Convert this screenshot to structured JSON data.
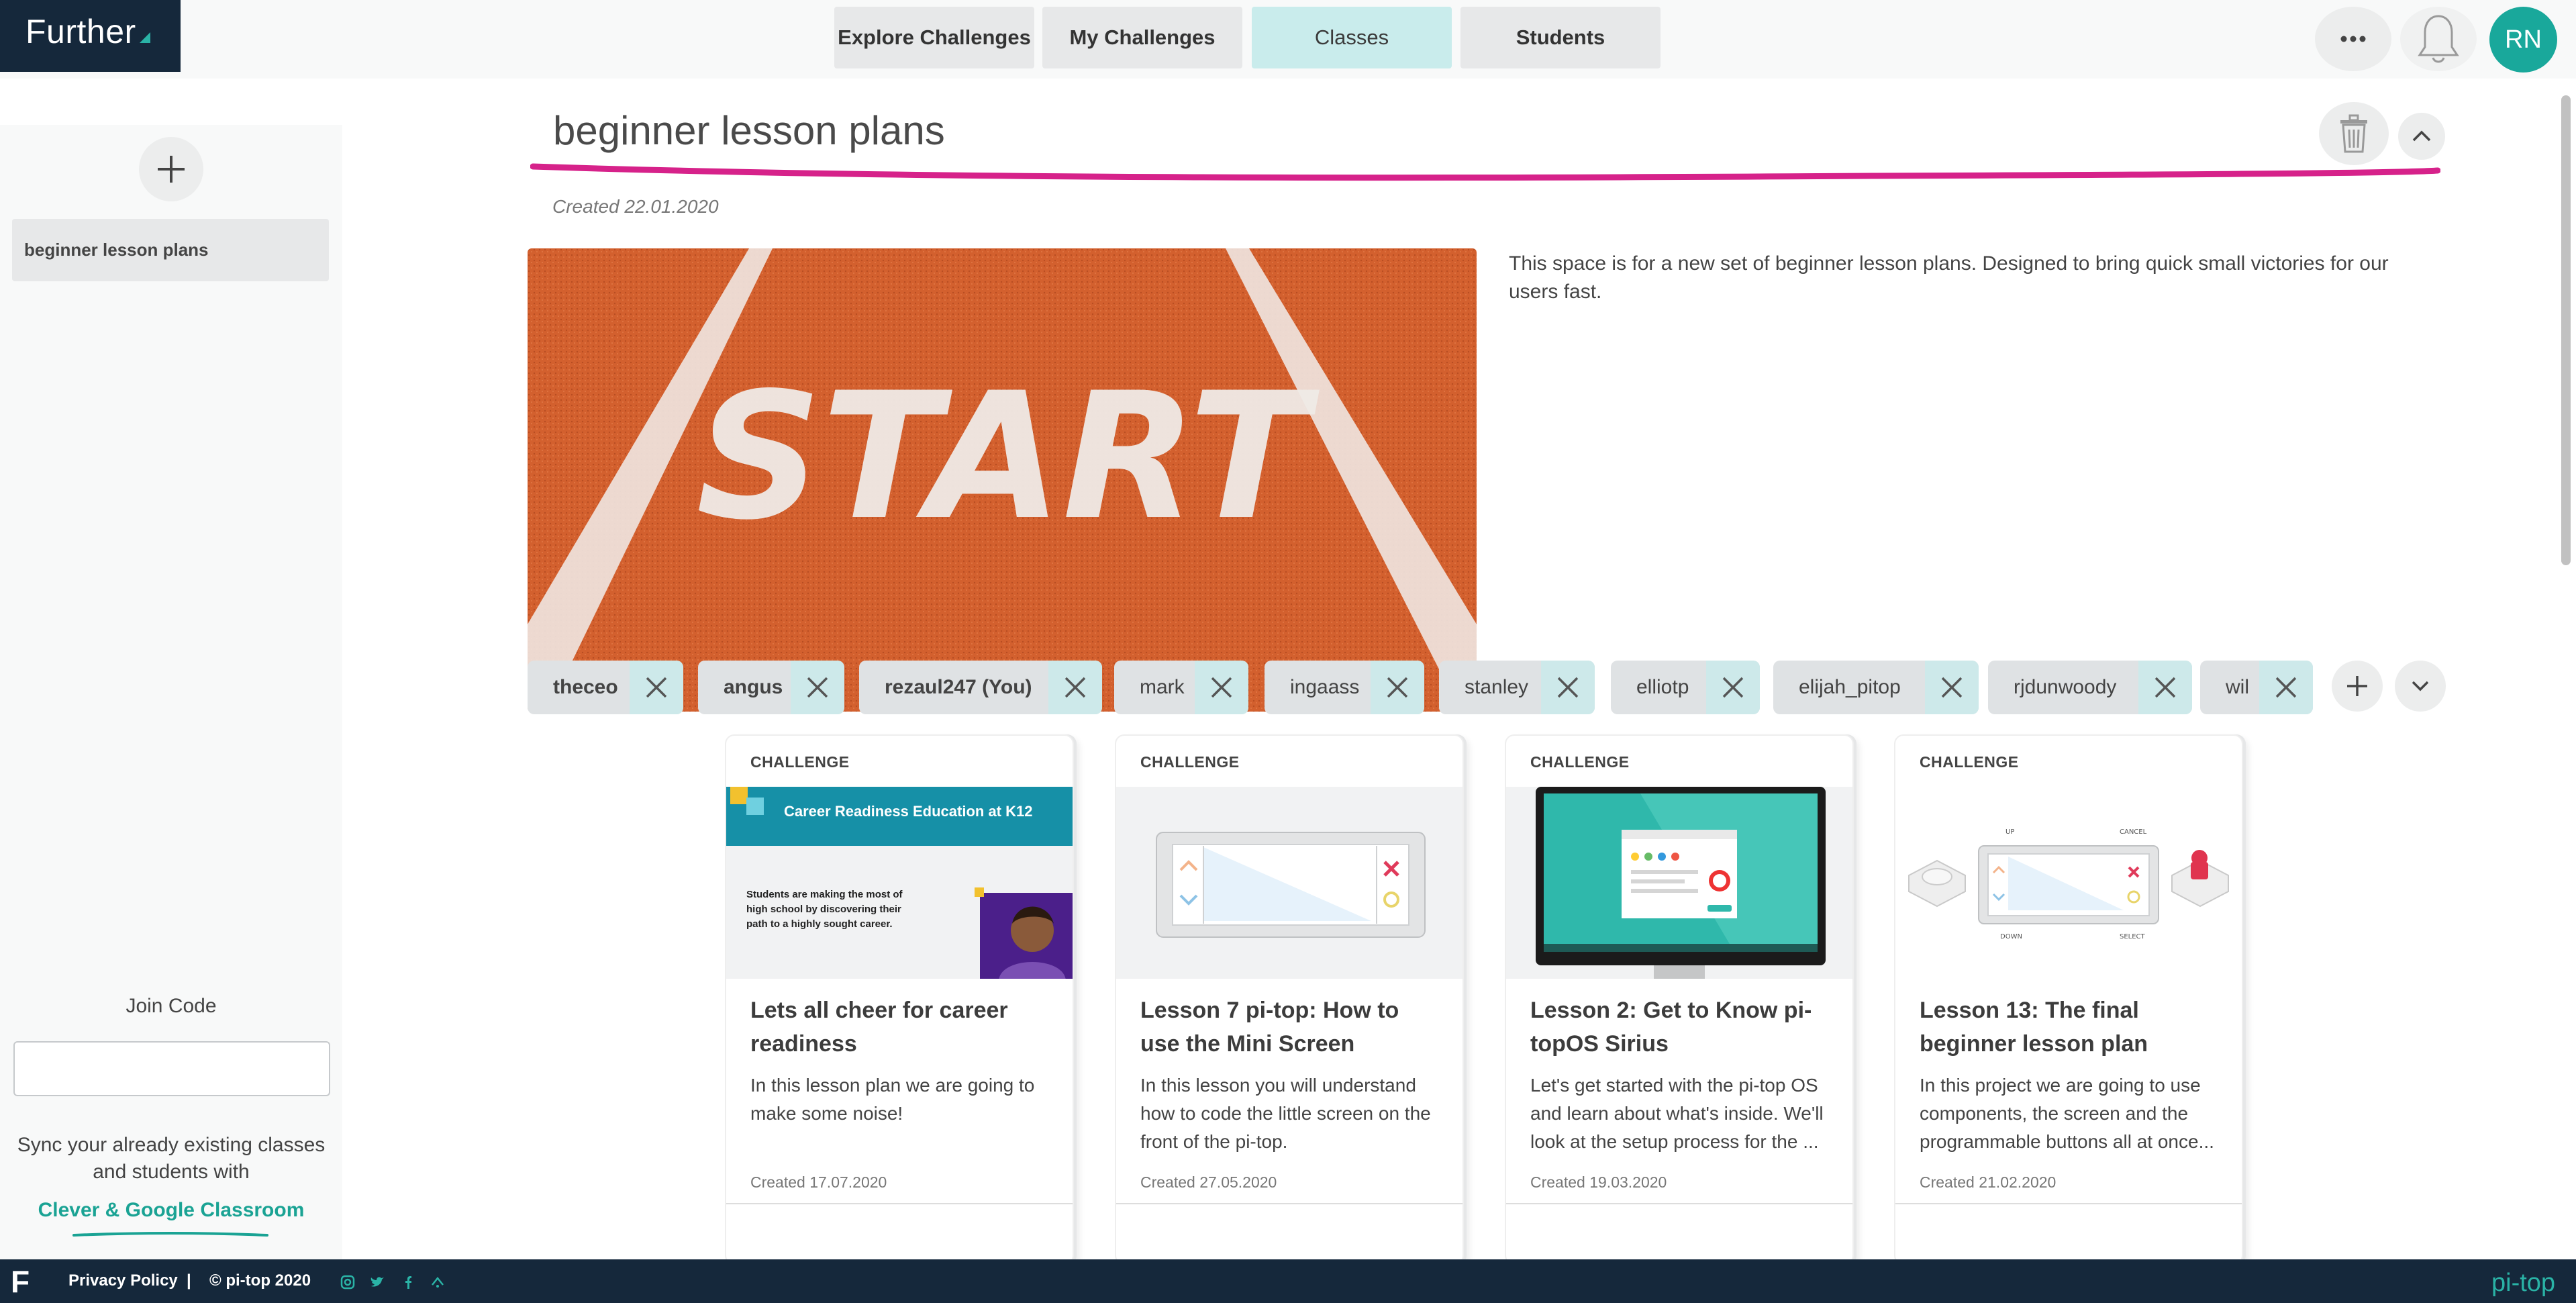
{
  "app": {
    "logo_text": "Further",
    "user_initials": "RN"
  },
  "nav": {
    "tabs": [
      {
        "label": "Explore Challenges"
      },
      {
        "label": "My Challenges"
      },
      {
        "label": "Classes",
        "active": true
      },
      {
        "label": "Students"
      }
    ]
  },
  "sidebar": {
    "items": [
      {
        "label": "beginner lesson plans",
        "selected": true
      }
    ],
    "join_code_label": "Join Code",
    "join_code_value": "",
    "sync_text": "Sync your already existing classes and students with",
    "sync_link": "Clever & Google Classroom"
  },
  "class": {
    "title": "beginner lesson plans",
    "created": "Created 22.01.2020",
    "hero_text": "START",
    "description": "This space is for a new set of beginner lesson plans. Designed to bring quick small victories for our users fast.",
    "students": [
      {
        "name": "theceo",
        "bold": true
      },
      {
        "name": "angus",
        "bold": true
      },
      {
        "name": "rezaul247 (You)",
        "bold": true
      },
      {
        "name": "mark",
        "bold": false
      },
      {
        "name": "ingaass",
        "bold": false
      },
      {
        "name": "stanley",
        "bold": false
      },
      {
        "name": "elliotp",
        "bold": false
      },
      {
        "name": "elijah_pitop",
        "bold": false
      },
      {
        "name": "rjdunwoody",
        "bold": false
      },
      {
        "name": "wil",
        "bold": false
      }
    ]
  },
  "cards": [
    {
      "label": "CHALLENGE",
      "title": "Lets all cheer for career readiness",
      "desc": "In this lesson plan we are going to make some noise!",
      "date": "Created 17.07.2020",
      "img_banner": "Career Readiness Education at K12",
      "img_text": "Students are making the most of high school by discovering their path to a highly sought career."
    },
    {
      "label": "CHALLENGE",
      "title": "Lesson 7 pi-top: How to use the Mini Screen",
      "desc": "In this lesson you will understand how to code the little screen on the front of the pi-top.",
      "date": "Created 27.05.2020"
    },
    {
      "label": "CHALLENGE",
      "title": "Lesson 2: Get to Know pi-topOS Sirius",
      "desc": "Let's get started with the pi-top OS and learn about what's inside. We'll look at the setup process for the ...",
      "date": "Created 19.03.2020"
    },
    {
      "label": "CHALLENGE",
      "title": "Lesson 13: The final beginner lesson plan",
      "desc": "In this project we are going to use components, the screen and the programmable buttons all at once...",
      "date": "Created 21.02.2020",
      "img_labels": [
        "UP",
        "CANCEL",
        "DOWN",
        "SELECT"
      ]
    }
  ],
  "footer": {
    "logo": "F",
    "privacy": "Privacy Policy",
    "separator": "|",
    "copyright": "© pi-top 2020",
    "brand": "pi-top"
  },
  "colors": {
    "accent": "#19a89b",
    "title_underline": "#d6228a",
    "dark": "#15283b"
  }
}
